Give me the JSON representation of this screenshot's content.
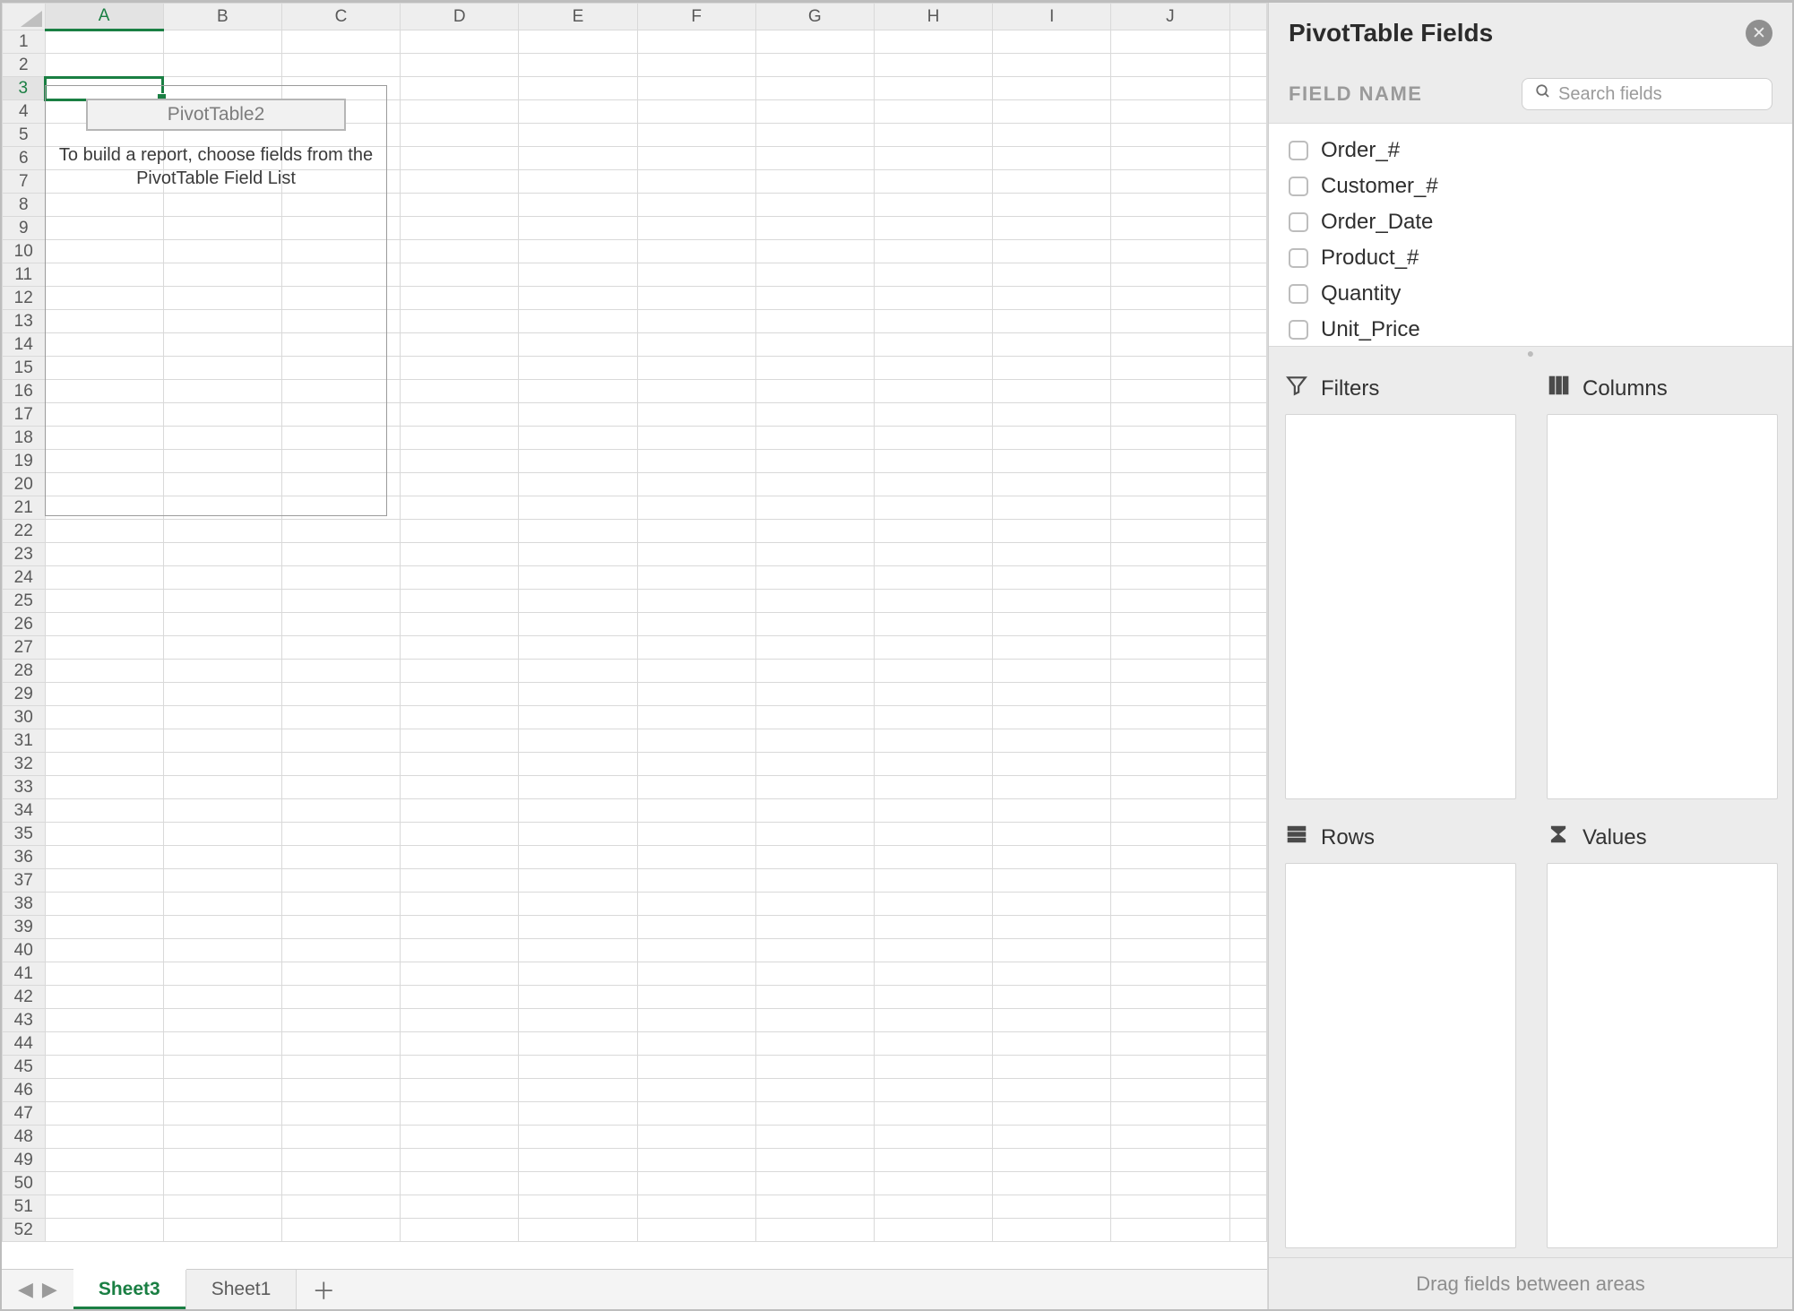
{
  "columns": [
    "A",
    "B",
    "C",
    "D",
    "E",
    "F",
    "G",
    "H",
    "I",
    "J"
  ],
  "row_count": 52,
  "active_cell": {
    "col": 0,
    "row": 3
  },
  "pivot_placeholder": {
    "name": "PivotTable2",
    "help": "To build a report, choose fields from the PivotTable Field List"
  },
  "tabs": {
    "items": [
      {
        "label": "Sheet3",
        "active": true
      },
      {
        "label": "Sheet1",
        "active": false
      }
    ]
  },
  "panel": {
    "title": "PivotTable Fields",
    "fieldname_label": "FIELD NAME",
    "search_placeholder": "Search fields",
    "fields": [
      "Order_#",
      "Customer_#",
      "Order_Date",
      "Product_#",
      "Quantity",
      "Unit_Price"
    ],
    "zones": {
      "filters": "Filters",
      "columns": "Columns",
      "rows": "Rows",
      "values": "Values"
    },
    "footer": "Drag fields between areas"
  }
}
